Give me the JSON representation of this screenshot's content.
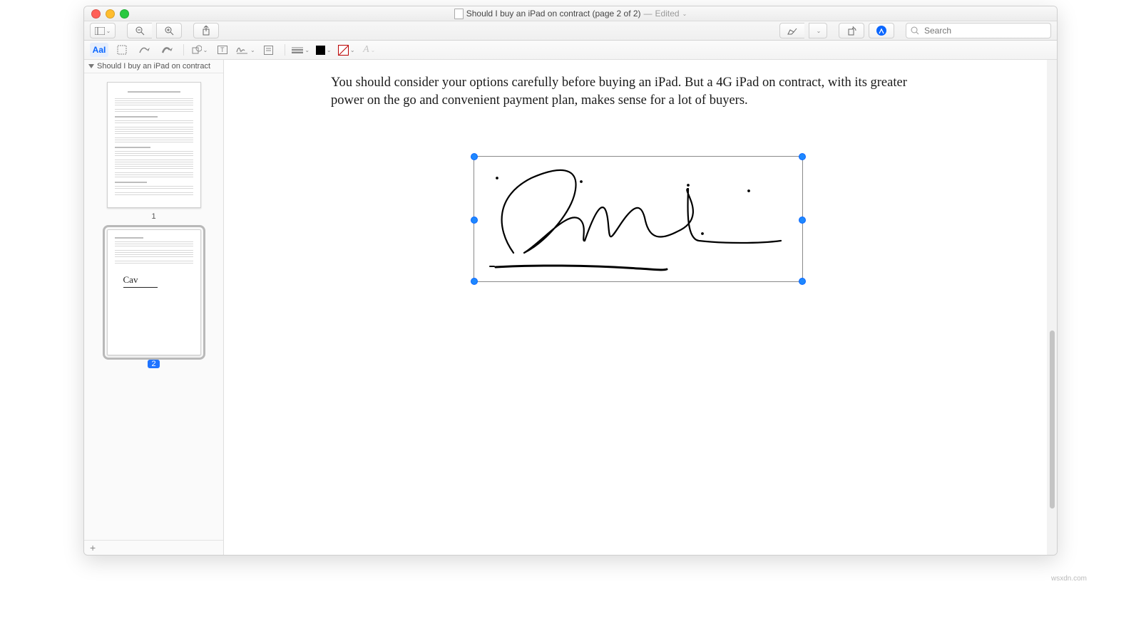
{
  "window": {
    "doc_title": "Should I buy an iPad on contract (page 2 of 2)",
    "edited_label": "Edited",
    "search_placeholder": "Search"
  },
  "sidebar": {
    "outline_title": "Should I buy an iPad on contract",
    "pages": [
      {
        "label": "1",
        "selected": false
      },
      {
        "label": "2",
        "selected": true
      }
    ],
    "add_label": "+"
  },
  "document": {
    "paragraph": "You should consider your options carefully before buying an iPad. But a 4G iPad on contract, with its greater power on the go and convenient payment plan, makes sense for a lot of buyers."
  },
  "annotation_tools": {
    "text_style_label": "AaI"
  },
  "watermark": "wsxdn.com"
}
